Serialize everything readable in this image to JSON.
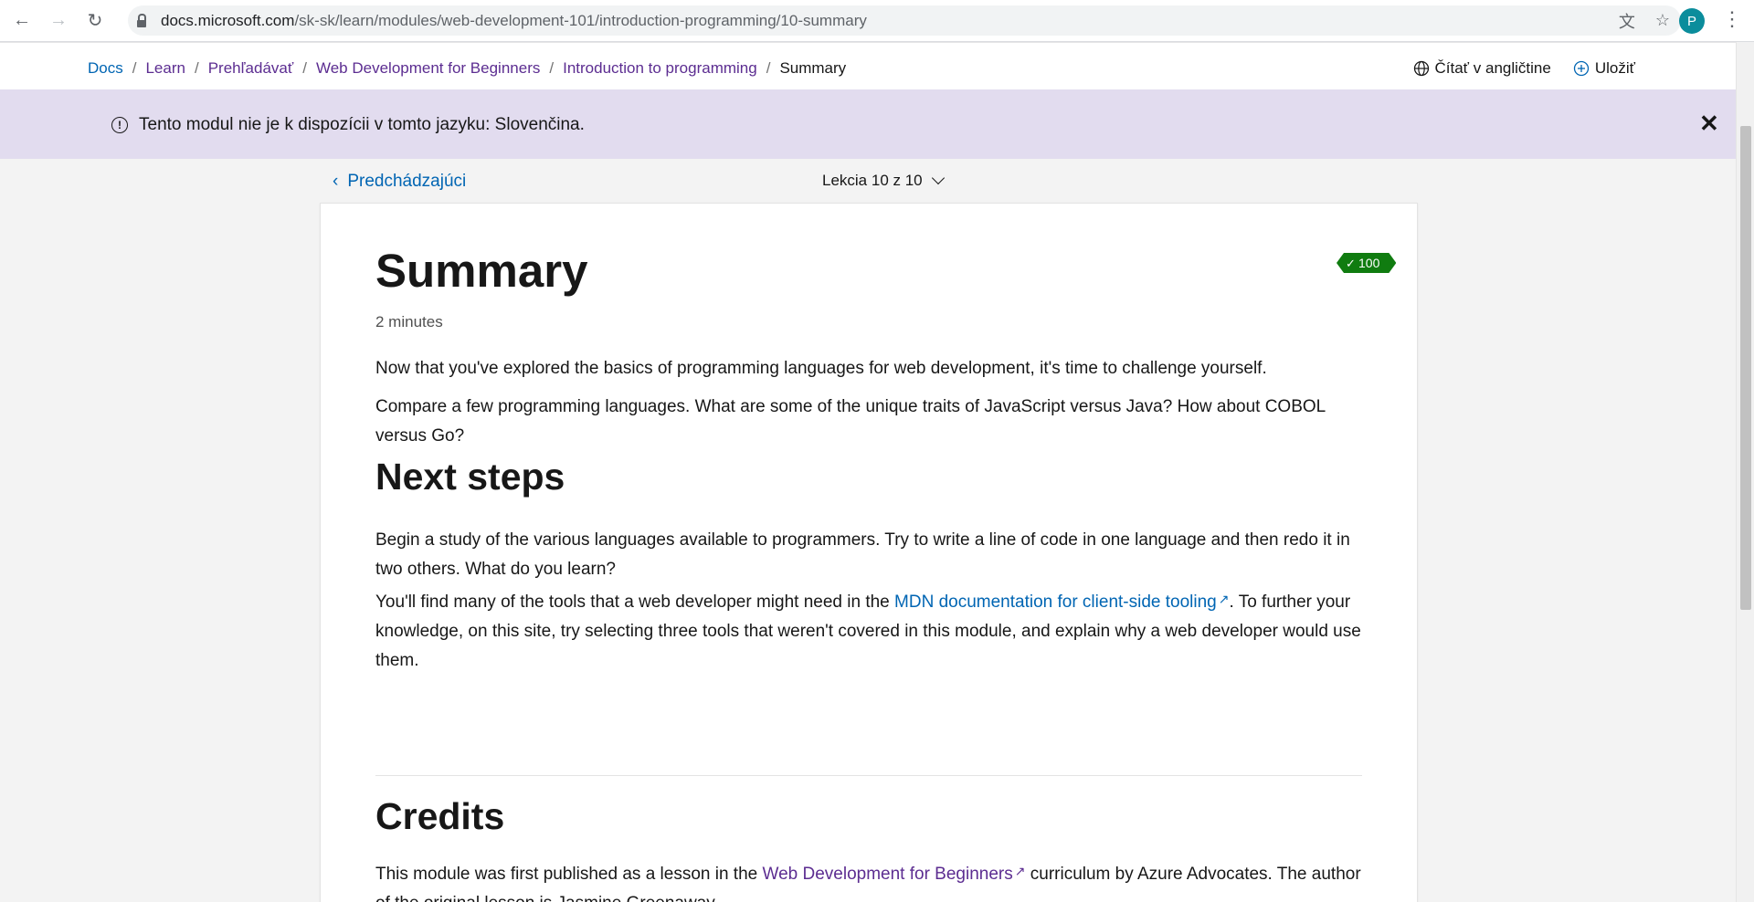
{
  "browser": {
    "url_host": "docs.microsoft.com",
    "url_path": "/sk-sk/learn/modules/web-development-101/introduction-programming/10-summary",
    "avatar_letter": "P"
  },
  "breadcrumb": {
    "items": [
      "Docs",
      "Learn",
      "Prehľadávať",
      "Web Development for Beginners",
      "Introduction to programming"
    ],
    "current": "Summary"
  },
  "actions": {
    "read_english": "Čítať v angličtine",
    "save": "Uložiť"
  },
  "banner": {
    "text": "Tento modul nie je k dispozícii v tomto jazyku: Slovenčina."
  },
  "lesson_nav": {
    "previous": "Predchádzajúci",
    "counter": "Lekcia 10 z 10"
  },
  "unit": {
    "xp": "100 XP",
    "title": "Summary",
    "duration": "2 minutes",
    "para1": "Now that you've explored the basics of programming languages for web development, it's time to challenge yourself.",
    "para2": "Compare a few programming languages. What are some of the unique traits of JavaScript versus Java? How about COBOL versus Go?",
    "next_steps_heading": "Next steps",
    "para3": "Begin a study of the various languages available to programmers. Try to write a line of code in one language and then redo it in two others. What do you learn?",
    "para4_before": "You'll find many of the tools that a web developer might need in the ",
    "para4_link": "MDN documentation for client-side tooling",
    "para4_after": ". To further your knowledge, on this site, try selecting three tools that weren't covered in this module, and explain why a web developer would use them.",
    "credits_heading": "Credits",
    "para5_before": "This module was first published as a lesson in the ",
    "para5_link": "Web Development for Beginners",
    "para5_after": " curriculum by Azure Advocates. The author of the original lesson is Jasmine Greenaway."
  },
  "icons": {
    "back": "arrow-left-icon",
    "forward": "arrow-right-icon",
    "reload": "reload-icon",
    "translate": "translate-icon",
    "star": "star-icon",
    "globe": "globe-icon",
    "add": "plus-circle-icon",
    "info": "info-icon",
    "close": "close-icon"
  },
  "colors": {
    "link": "#0065b3",
    "visited": "#5c2d91",
    "banner": "#e2dcef",
    "xp_badge": "#107c10"
  }
}
